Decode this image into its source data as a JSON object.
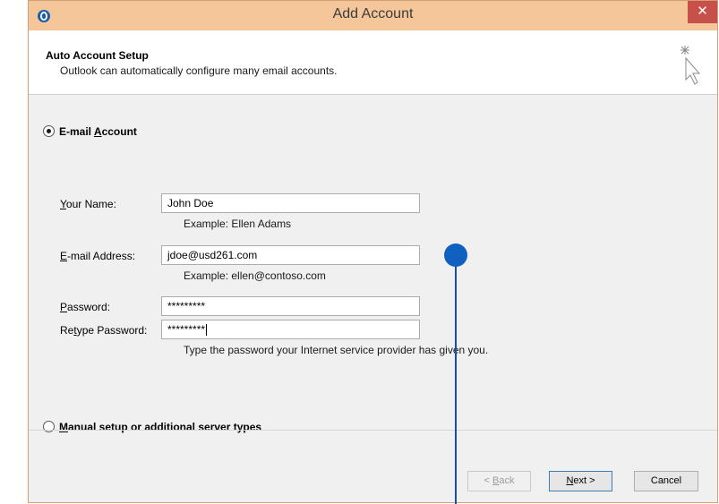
{
  "window": {
    "title": "Add Account",
    "close_label": "✕"
  },
  "header": {
    "title": "Auto Account Setup",
    "subtitle": "Outlook can automatically configure many email accounts."
  },
  "email_account": {
    "label_pre": "E-mail ",
    "label_accel": "A",
    "label_post": "ccount",
    "selected": true
  },
  "form": {
    "your_name": {
      "label_accel": "Y",
      "label_rest": "our Name:",
      "value": "John Doe",
      "example": "Example: Ellen Adams"
    },
    "email_address": {
      "label_accel": "E",
      "label_rest": "-mail Address:",
      "value": "jdoe@usd261.com",
      "example": "Example: ellen@contoso.com"
    },
    "password": {
      "label_accel": "P",
      "label_rest": "assword:",
      "value": "*********"
    },
    "retype_password": {
      "label_pre": "Re",
      "label_accel": "t",
      "label_rest": "ype Password:",
      "value": "*********"
    },
    "password_hint": "Type the password your Internet service provider has given you."
  },
  "manual_setup": {
    "label_accel": "M",
    "label_rest": "anual setup or additional server types",
    "selected": false
  },
  "buttons": {
    "back": {
      "pre": "< ",
      "accel": "B",
      "rest": "ack",
      "enabled": false
    },
    "next": {
      "accel": "N",
      "rest": "ext >",
      "enabled": true
    },
    "cancel": {
      "label": "Cancel"
    }
  },
  "colors": {
    "titlebar": "#f5c69a",
    "close": "#c7504a",
    "callout": "#1060c0"
  }
}
